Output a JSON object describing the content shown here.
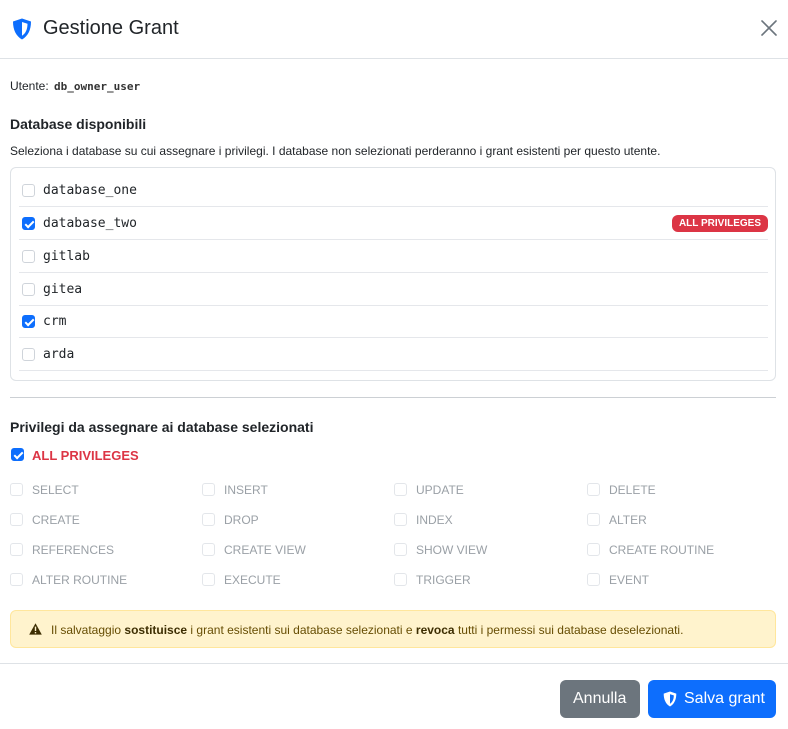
{
  "modal": {
    "title": "Gestione Grant",
    "title_icon": "shield-icon",
    "close_icon": "close-icon"
  },
  "user": {
    "label": "Utente:",
    "name": "db_owner_user"
  },
  "databases": {
    "title": "Database disponibili",
    "help": "Seleziona i database su cui assegnare i privilegi. I database non selezionati perderanno i grant esistenti per questo utente.",
    "items": [
      {
        "name": "database_one",
        "checked": false,
        "badge": ""
      },
      {
        "name": "database_two",
        "checked": true,
        "badge": "ALL PRIVILEGES"
      },
      {
        "name": "gitlab",
        "checked": false,
        "badge": ""
      },
      {
        "name": "gitea",
        "checked": false,
        "badge": ""
      },
      {
        "name": "crm",
        "checked": true,
        "badge": ""
      },
      {
        "name": "arda",
        "checked": false,
        "badge": ""
      }
    ]
  },
  "privileges": {
    "title": "Privilegi da assegnare ai database selezionati",
    "all_label": "ALL PRIVILEGES",
    "all_checked": true,
    "items": [
      "SELECT",
      "INSERT",
      "UPDATE",
      "DELETE",
      "CREATE",
      "DROP",
      "INDEX",
      "ALTER",
      "REFERENCES",
      "CREATE VIEW",
      "SHOW VIEW",
      "CREATE ROUTINE",
      "ALTER ROUTINE",
      "EXECUTE",
      "TRIGGER",
      "EVENT"
    ]
  },
  "alert": {
    "icon": "warning-icon",
    "part1": "Il salvataggio ",
    "bold1": "sostituisce",
    "part2": " i grant esistenti sui database selezionati e ",
    "bold2": "revoca",
    "part3": " tutti i permessi sui database deselezionati.",
    "color_bg": "#fff3cd"
  },
  "footer": {
    "cancel_label": "Annulla",
    "save_label": "Salva grant",
    "save_icon": "shield-icon"
  },
  "colors": {
    "primary": "#0d6efd",
    "danger": "#dc3545",
    "secondary": "#6c757d"
  }
}
